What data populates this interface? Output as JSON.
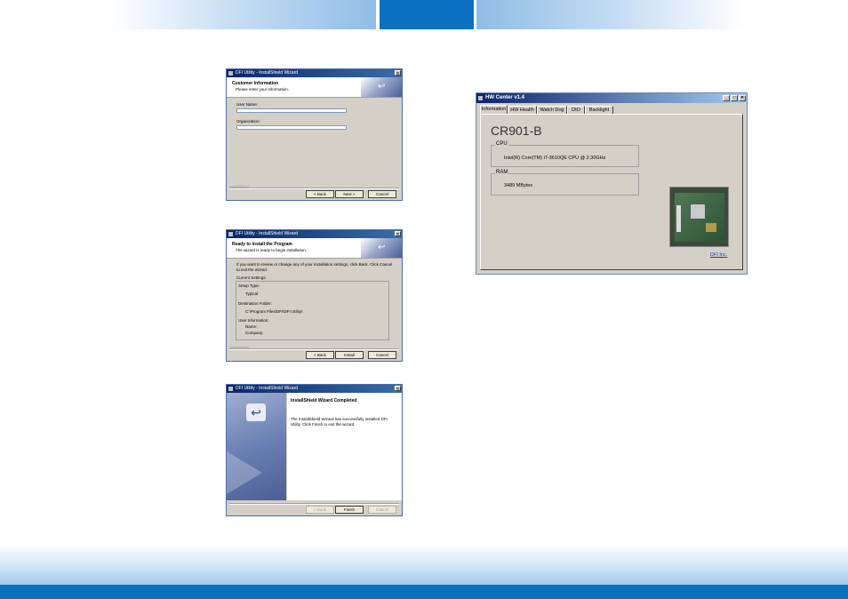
{
  "dialog1": {
    "title": "DFI Utility - InstallShield Wizard",
    "heading": "Customer Information",
    "subheading": "Please enter your information.",
    "username_label": "User Name:",
    "username_value": "",
    "org_label": "Organization:",
    "org_value": "",
    "brand": "InstallShield",
    "back": "< Back",
    "next": "Next >",
    "cancel": "Cancel"
  },
  "dialog2": {
    "title": "DFI Utility - InstallShield Wizard",
    "heading": "Ready to Install the Program",
    "subheading": "The wizard is ready to begin installation.",
    "intro": "If you want to review or change any of your installation settings, click Back. Click Cancel to exit the wizard.",
    "current_settings": "Current Settings:",
    "setup_type_label": "Setup Type:",
    "setup_type_value": "Typical",
    "dest_label": "Destination Folder:",
    "dest_value": "C:\\Program Files\\DFI\\DFI Utility\\",
    "user_info_label": "User Information:",
    "name_label": "Name:",
    "company_label": "Company:",
    "brand": "InstallShield",
    "back": "< Back",
    "install": "Install",
    "cancel": "Cancel"
  },
  "dialog3": {
    "title": "DFI Utility - InstallShield Wizard",
    "heading": "InstallShield Wizard Completed",
    "message": "The InstallShield Wizard has successfully installed DFI Utility. Click Finish to exit the wizard.",
    "back": "< Back",
    "finish": "Finish",
    "cancel": "Cancel"
  },
  "hw_center": {
    "title": "HW Center v1.4",
    "tabs": [
      "Information",
      "HW Health",
      "Watch Dog",
      "DIO",
      "Backlight"
    ],
    "model": "CR901-B",
    "cpu_label": "CPU",
    "cpu_value": "Intel(R) Core(TM) i7-3610QE CPU @ 2.30GHz",
    "ram_label": "RAM",
    "ram_value": "3489 MBytes",
    "link": "DFI Inc."
  }
}
